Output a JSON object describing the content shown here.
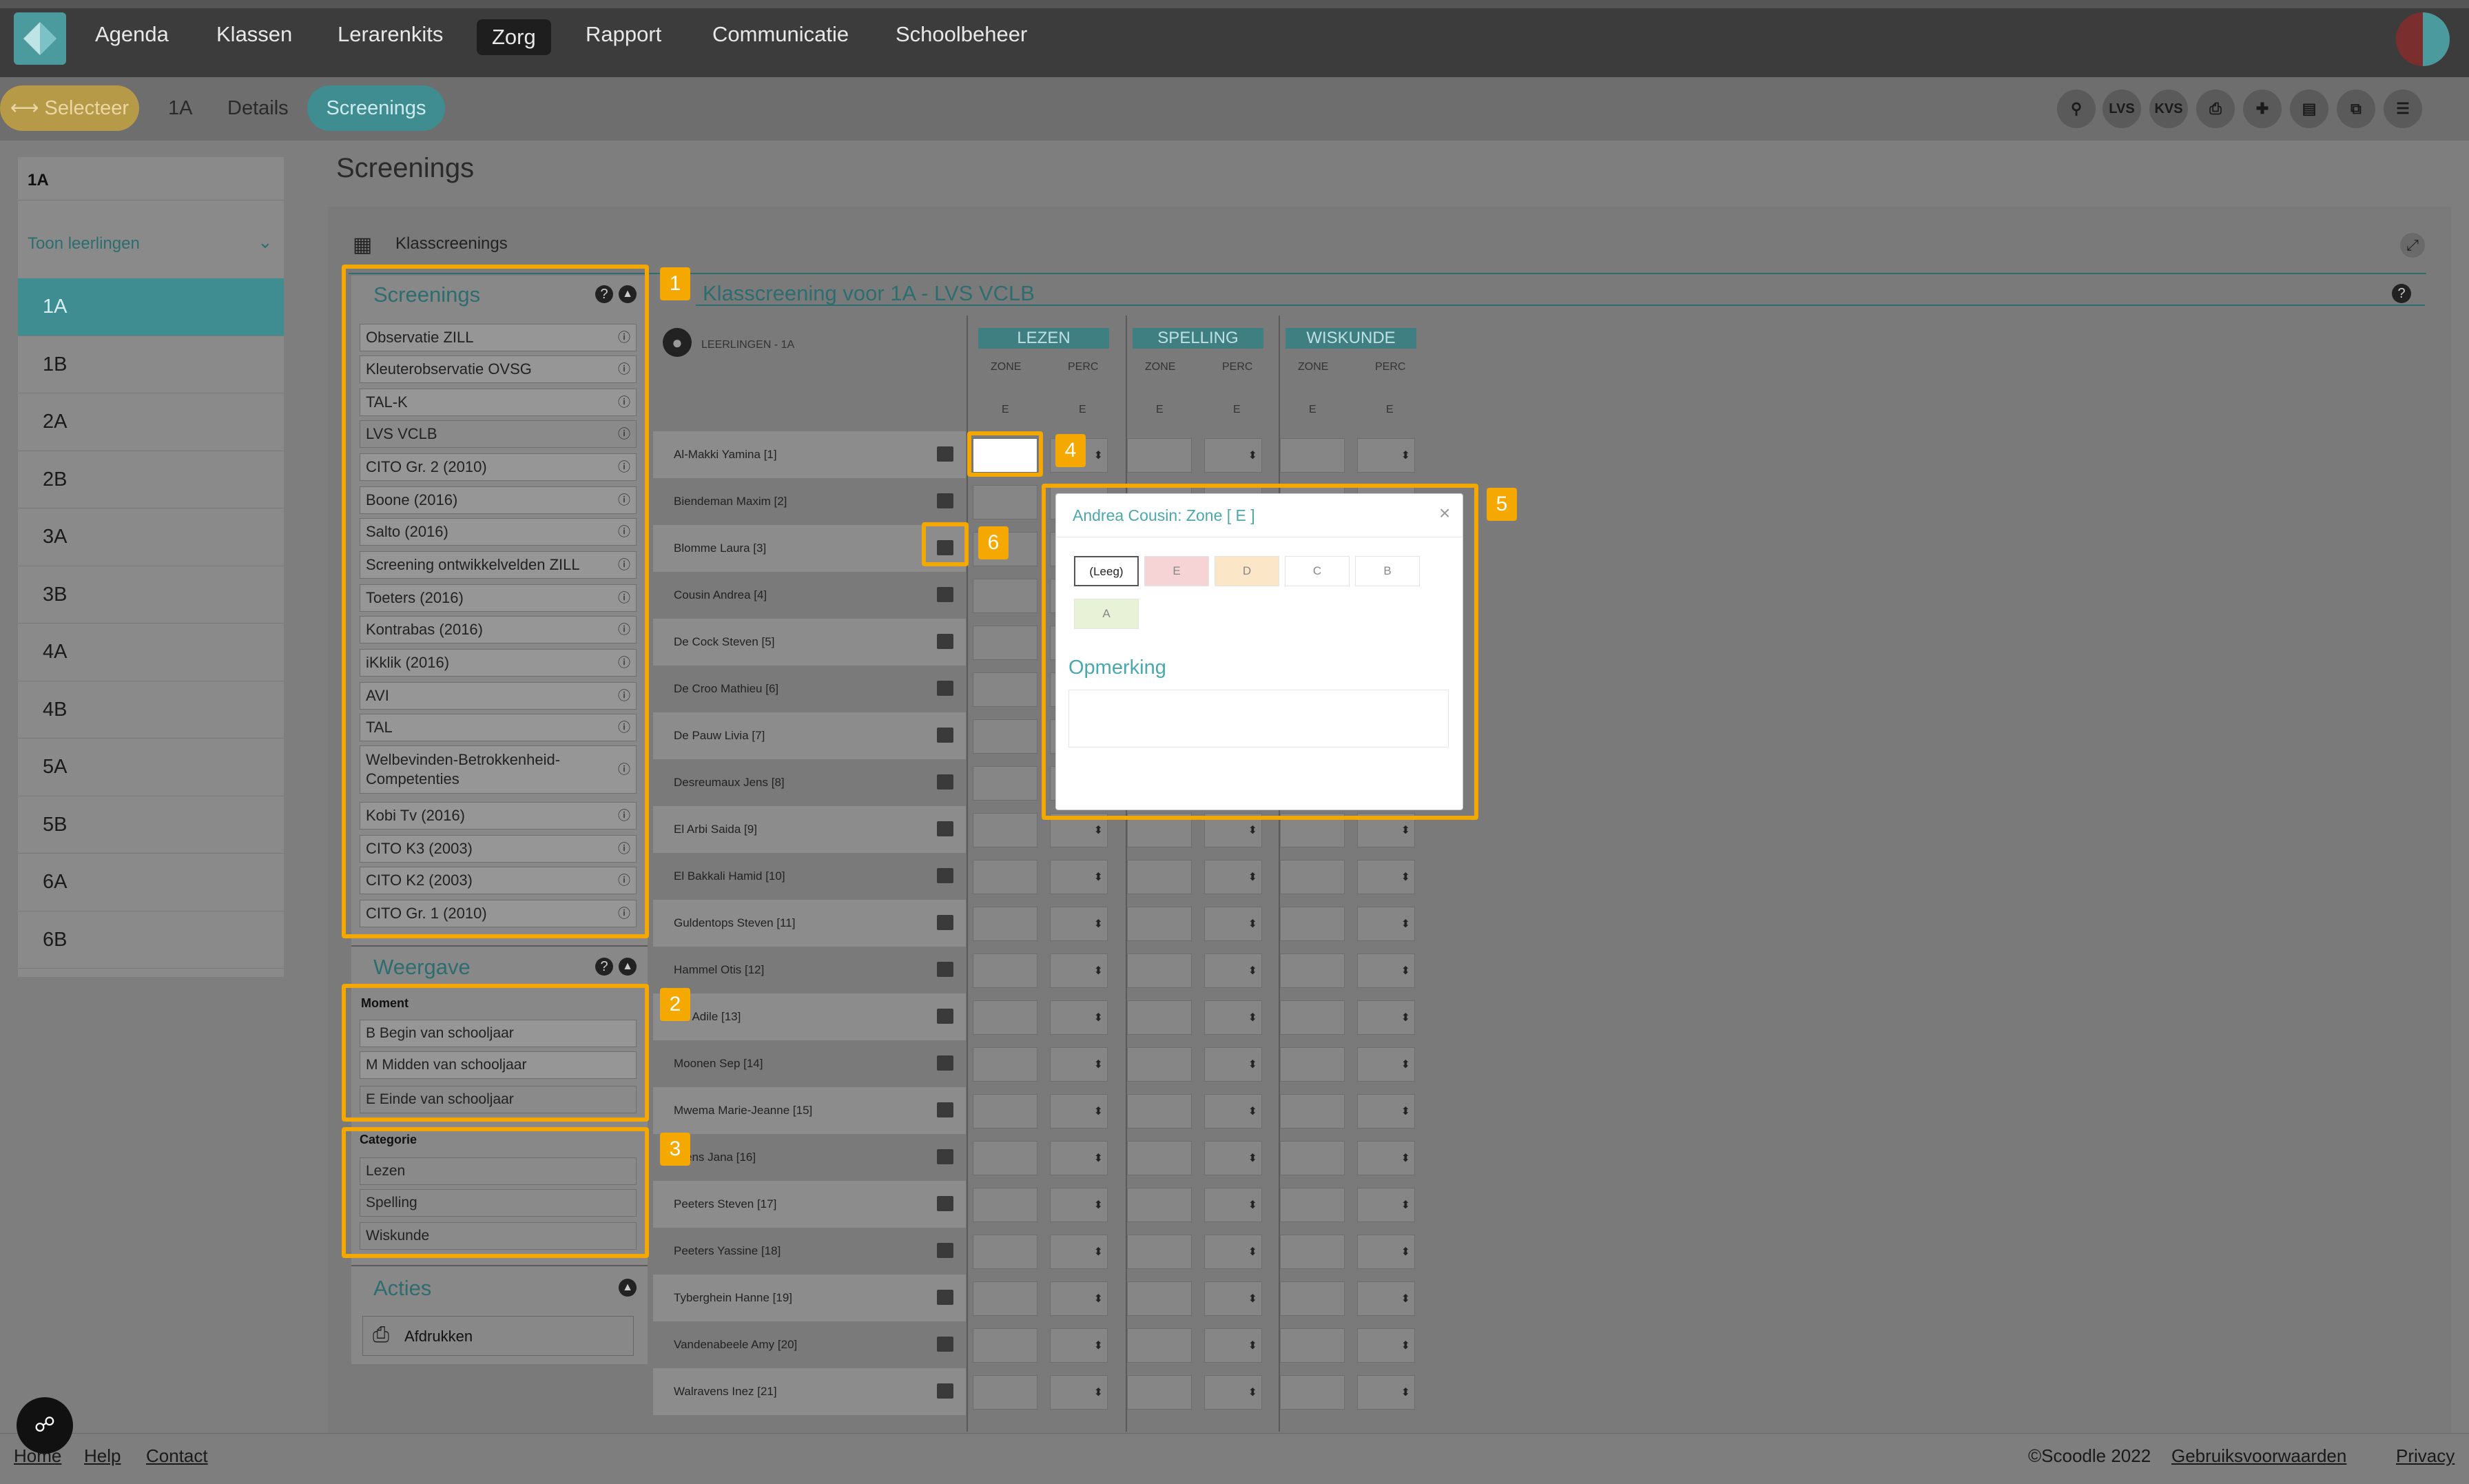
{
  "nav": {
    "items": [
      "Agenda",
      "Klassen",
      "Lerarenkits",
      "Zorg",
      "Rapport",
      "Communicatie",
      "Schoolbeheer"
    ],
    "active": "Zorg"
  },
  "subbar": {
    "select_label": "⟷ Selecteer",
    "class_label": "1A",
    "details_label": "Details",
    "screenings_label": "Screenings",
    "tools": [
      "search-icon",
      "LVS",
      "KVS",
      "print-icon",
      "file-add-icon",
      "archive-icon",
      "copy-icon",
      "clipboard-icon"
    ]
  },
  "left": {
    "class_value": "1A",
    "toggle_label": "Toon leerlingen",
    "classes": [
      "1A",
      "1B",
      "2A",
      "2B",
      "3A",
      "3B",
      "4A",
      "4B",
      "5A",
      "5B",
      "6A",
      "6B"
    ],
    "selected": "1A"
  },
  "page": {
    "title": "Screenings",
    "card_title": "Klasscreenings",
    "grid_title": "Klasscreening voor 1A - LVS VCLB"
  },
  "screenings": {
    "header": "Screenings",
    "items": [
      "Observatie ZILL",
      "Kleuterobservatie OVSG",
      "TAL-K",
      "LVS VCLB",
      "CITO Gr. 2 (2010)",
      "Boone (2016)",
      "Salto (2016)",
      "Screening ontwikkelvelden ZILL",
      "Toeters (2016)",
      "Kontrabas (2016)",
      "iKklik (2016)",
      "AVI",
      "TAL",
      "Welbevinden-Betrokkenheid-Competenties",
      "Kobi Tv (2016)",
      "CITO K3 (2003)",
      "CITO K2 (2003)",
      "CITO Gr. 1 (2010)"
    ],
    "selected": "LVS VCLB"
  },
  "weergave": {
    "header": "Weergave",
    "moment_label": "Moment",
    "moments": [
      "B Begin van schooljaar",
      "M Midden van schooljaar",
      "E Einde van schooljaar"
    ],
    "categorie_label": "Categorie",
    "categories": [
      "Lezen",
      "Spelling",
      "Wiskunde"
    ]
  },
  "acties": {
    "header": "Acties",
    "print_label": "Afdrukken"
  },
  "grid": {
    "students_header": "LEERLINGEN - 1A",
    "subjects": [
      "LEZEN",
      "SPELLING",
      "WISKUNDE"
    ],
    "col_zone": "ZONE",
    "col_perc": "PERC",
    "moment_letter": "E",
    "students": [
      "Al-Makki Yamina [1]",
      "Biendeman Maxim [2]",
      "Blomme Laura [3]",
      "Cousin Andrea [4]",
      "De Cock Steven [5]",
      "De Croo Mathieu [6]",
      "De Pauw Livia [7]",
      "Desreumaux Jens [8]",
      "El Arbi Saida [9]",
      "El Bakkali Hamid [10]",
      "Guldentops Steven [11]",
      "Hammel Otis [12]",
      "bal Adile [13]",
      "Moonen Sep [14]",
      "Mwema Marie-Jeanne [15]",
      "ssens Jana [16]",
      "Peeters Steven [17]",
      "Peeters Yassine [18]",
      "Tyberghein Hanne [19]",
      "Vandenabeele Amy [20]",
      "Walravens Inez [21]"
    ]
  },
  "popup": {
    "title": "Andrea Cousin: Zone [ E ]",
    "close": "×",
    "zones": [
      "(Leeg)",
      "E",
      "D",
      "C",
      "B",
      "A"
    ],
    "remark_label": "Opmerking"
  },
  "badges": [
    "1",
    "2",
    "3",
    "4",
    "5",
    "6"
  ],
  "footer": {
    "links": [
      "Home",
      "Help",
      "Contact"
    ],
    "copyright": "©Scoodle 2022",
    "terms": "Gebruiksvoorwaarden",
    "privacy": "Privacy",
    "chat_icon": "chat-icon"
  }
}
